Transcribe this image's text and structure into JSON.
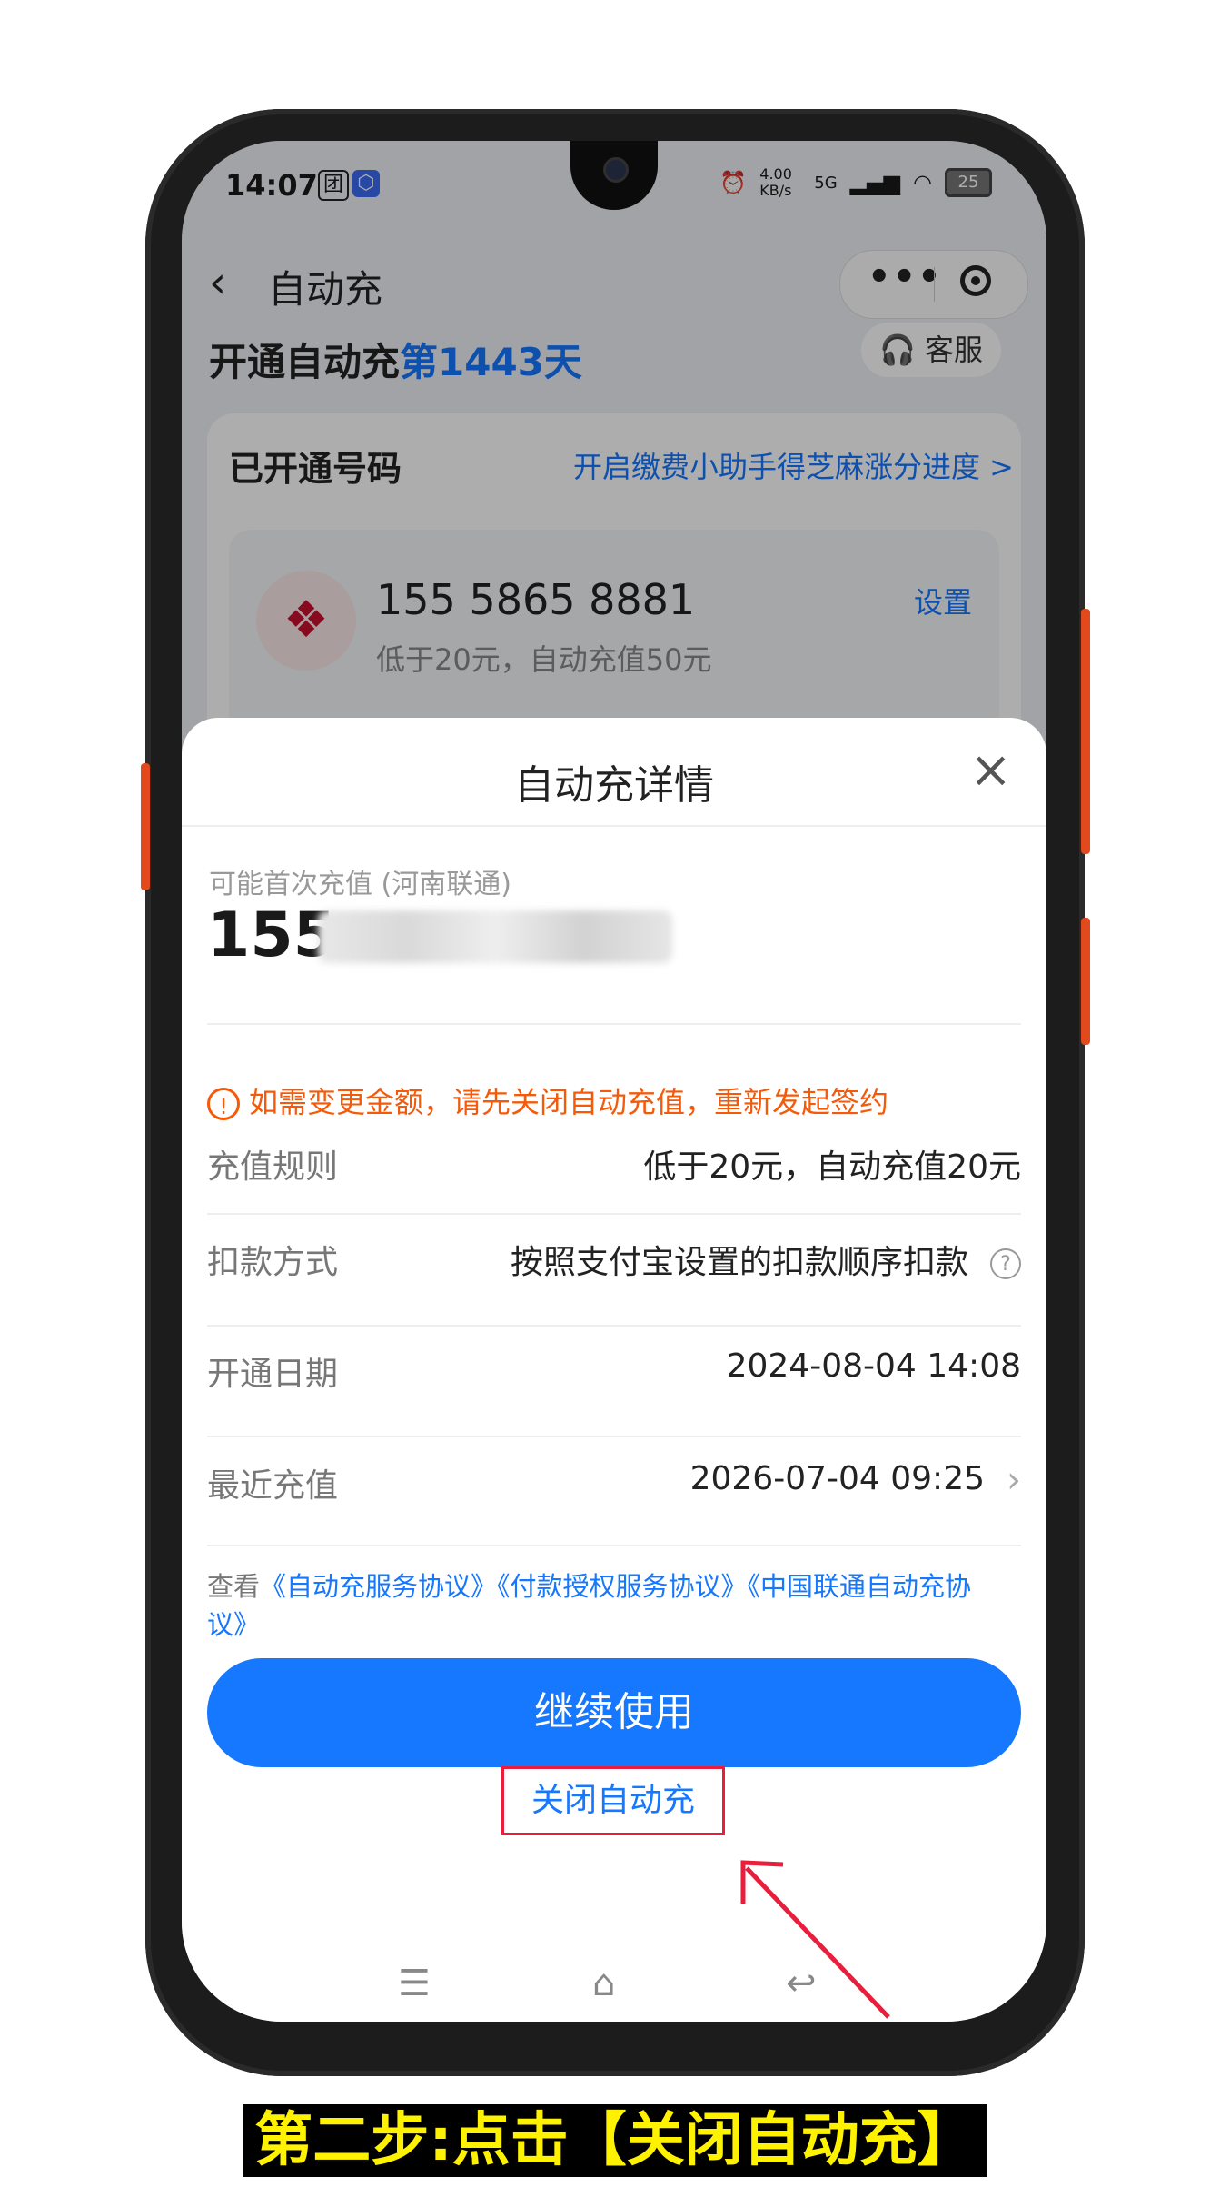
{
  "status_bar": {
    "time": "14:07",
    "icon1": "团",
    "net_speed": "4.00 KB/s",
    "network": "5G",
    "battery": "25"
  },
  "navbar": {
    "back_icon": "chevron-left-icon",
    "title": "自动充"
  },
  "background": {
    "headline_prefix": "开通自动充",
    "headline_days": "第1443天",
    "customer_service": "客服",
    "section_label": "已开通号码",
    "assist_link": "开启缴费小助手得芝麻涨分进度 >",
    "number": "155 5865 8881",
    "rule": "低于20元，自动充值50元",
    "settings": "设置"
  },
  "sheet": {
    "title": "自动充详情",
    "first_label": "可能首次充值 (河南联通)",
    "phone_prefix": "155",
    "warning": "如需变更金额，请先关闭自动充值，重新发起签约",
    "rows": [
      {
        "key": "充值规则",
        "value": "低于20元，自动充值20元"
      },
      {
        "key": "扣款方式",
        "value": "按照支付宝设置的扣款顺序扣款"
      },
      {
        "key": "开通日期",
        "value": "2024-08-04 14:08"
      },
      {
        "key": "最近充值",
        "value": "2026-07-04 09:25"
      }
    ],
    "agreement_prefix": "查看",
    "agreement_links": "《自动充服务协议》《付款授权服务协议》《中国联通自动充协议》",
    "primary_button": "继续使用",
    "close_auto": "关闭自动充"
  },
  "caption": "第二步:点击【关闭自动充】",
  "colors": {
    "accent": "#1677ff",
    "warning": "#f55a0a",
    "highlight": "#e81e3c",
    "caption_text": "#fff200"
  }
}
